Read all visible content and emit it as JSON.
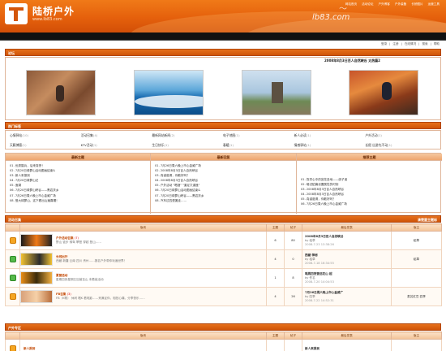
{
  "header": {
    "site_name": "陆桥户外",
    "site_url": "www.lb83.com",
    "brand_url": "lb83.com",
    "topnav": [
      "网站首页",
      "活动论坛",
      "户外博客",
      "户外装备",
      "长桥图片",
      "运营工具"
    ]
  },
  "userbar": {
    "links": [
      "登录",
      "注册",
      "在线情况",
      "搜索",
      "帮助"
    ]
  },
  "photos": {
    "section_title": "论坛",
    "caption": "2008年8月3日百人自然峡谷   太热篇2",
    "items": [
      "攀岩",
      "海浪",
      "纪念碑",
      "攀岩"
    ]
  },
  "tags": {
    "section_title": "热门标签",
    "items": [
      {
        "label": "心情驿站",
        "count": "(10)"
      },
      {
        "label": "活动召集",
        "count": "(4)"
      },
      {
        "label": "最新网站新闻",
        "count": "(2)"
      },
      {
        "label": "电子地图",
        "count": "(1)"
      },
      {
        "label": "新人必读",
        "count": "(1)"
      },
      {
        "label": "户外活动",
        "count": "(1)"
      },
      {
        "label": "天籁博客",
        "count": "(1)"
      },
      {
        "label": "KTV活动",
        "count": "(1)"
      },
      {
        "label": "生日快乐",
        "count": "(1)"
      },
      {
        "label": "春暖",
        "count": "(1)"
      },
      {
        "label": "情感驿站",
        "count": "(1)"
      },
      {
        "label": "长假 出游先不动",
        "count": "(1)"
      },
      {
        "label": "知足常乐",
        "count": "(1)"
      },
      {
        "label": "摄影相关说明",
        "count": "(1)"
      }
    ]
  },
  "columns": {
    "newest": {
      "title": "最新主题",
      "items": [
        "01. 优秀摄兵，后来真惨！",
        "02. 7月20日绿萝山活动图画结束&",
        "03. 新人来报到",
        "04. 7月20日绿萝山记",
        "05. 面湖",
        "06. 7月20日绿萝山峡谷——黑岩扶乡",
        "07. 7月26日周六晚上市心金威广场",
        "08. 登大绿萝山，这下看出山遍喜喔！"
      ]
    },
    "hottest": {
      "title": "最新回复",
      "items": [
        "01. 7月26日周六晚上市心金威广场",
        "02. 2008年8月3日百人自然峡谷",
        "03. 真诚邀请，你散好吗？",
        "04. 2008年8月3日百人自然峡谷",
        "05. 户外活动 \"喝酒\" \"道足又道遥\"",
        "06. 7月20日绿萝山活动图画结束&",
        "07. 7月20日绿萝山峡谷——黑岩扶乡",
        "08. 汽车过四堡搬走……"
      ]
    },
    "recommend": {
      "title": "推荐主题",
      "items": [
        "01. 探寻心中的宜花圣地——统子溪",
        "02. 暗试贴篇设置属性的时刻",
        "03. 2008年8月3日百人自然峡谷",
        "04. 2008年8月3日百人自然峡谷",
        "05. 真诚邀请，你散好吗？",
        "06. 7月26日周六晚上市心金威广场"
      ]
    }
  },
  "forum1": {
    "section_title": "活动召集",
    "section_right": "清楚屋主题标",
    "headers": [
      "",
      "版块",
      "主题",
      "帖子",
      "最后发表",
      "版主"
    ],
    "rows": [
      {
        "name": "户外活动召集",
        "count": "(7)",
        "desc": "野山 徒步 骑驾 攀登 穿越 登山……",
        "topics": "6",
        "posts": "80",
        "last_title": "2008年8月3日百人自然峡谷",
        "last_by": "by 稻草",
        "last_time": "2008-7-23 13:38:26",
        "mod": "稻草"
      },
      {
        "name": "长线出行",
        "count": "",
        "desc": "西藏 新疆 云南 四川 贵州……报名户外带你玩遍世界！",
        "topics": "4",
        "posts": "0",
        "last_title": "西藏·神秘",
        "last_by": "by 稻草",
        "last_time": "2008-7-18 16:34:55",
        "mod": "稻草"
      },
      {
        "name": "夏营活动",
        "count": "",
        "desc": "星期四到星期五加营至山\n未着装活动",
        "topics": "1",
        "posts": "8",
        "last_title": "喝周四夜营选花山  超",
        "last_by": "by 佚名",
        "last_time": "2008-7-20 14:04:53",
        "mod": ""
      },
      {
        "name": "FB召集",
        "count": "(3)",
        "desc": "FB（K歌） 休闲 唱K 看电影……来满足你，相拍心痛，分享快乐……",
        "topics": "4",
        "posts": "26",
        "last_title": "7月26日周六晚上市心金威广",
        "last_by": "by 四季",
        "last_time": "2008-7-22 14:52:31",
        "mod": "麦芫红豆  四季"
      }
    ]
  },
  "forum2": {
    "section_title": "户外专区",
    "headers": [
      "",
      "版块",
      "主题",
      "帖子",
      "最后发表",
      "版主"
    ],
    "rows": [
      {
        "name": "新人报到",
        "topics": "",
        "posts": "",
        "last_title": "新人来报到",
        "last_by": "",
        "last_time": "",
        "mod": ""
      }
    ]
  }
}
